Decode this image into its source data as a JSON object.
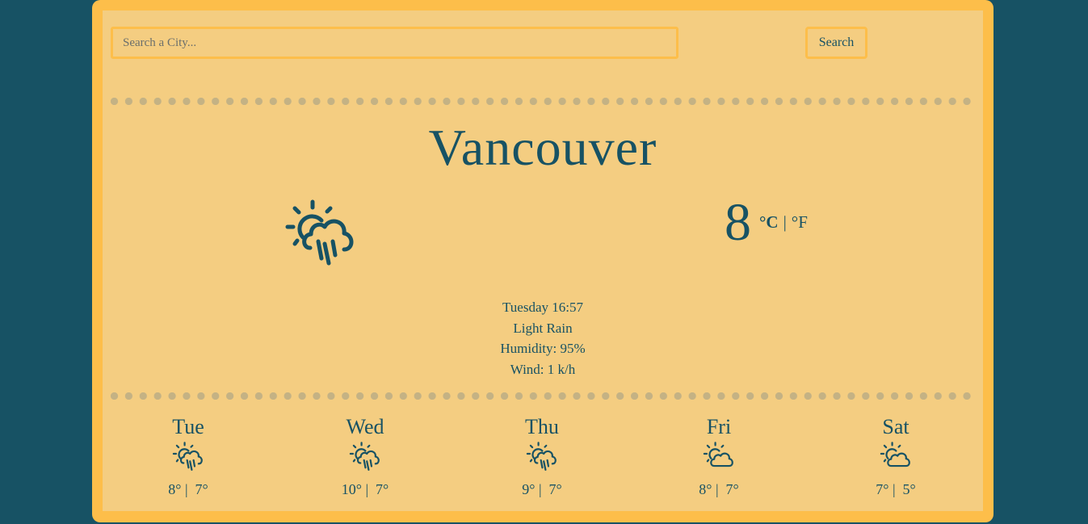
{
  "search": {
    "placeholder": "Search a City...",
    "value": "",
    "button_label": "Search"
  },
  "current": {
    "city": "Vancouver",
    "icon": "sun-cloud-rain-icon",
    "temperature": "8",
    "unit_celsius": "°C",
    "unit_separator": "|",
    "unit_fahrenheit": "°F",
    "datetime": "Tuesday 16:57",
    "description": "Light Rain",
    "humidity": "Humidity: 95%",
    "wind": "Wind: 1 k/h"
  },
  "forecast": [
    {
      "day": "Tue",
      "icon": "sun-cloud-rain-icon",
      "temps": "8° |  7°"
    },
    {
      "day": "Wed",
      "icon": "sun-cloud-rain-icon",
      "temps": "10° |  7°"
    },
    {
      "day": "Thu",
      "icon": "sun-cloud-rain-icon",
      "temps": "9° |  7°"
    },
    {
      "day": "Fri",
      "icon": "sun-cloud-icon",
      "temps": "8° |  7°"
    },
    {
      "day": "Sat",
      "icon": "sun-cloud-icon",
      "temps": "7° |  5°"
    }
  ],
  "colors": {
    "background": "#175264",
    "card_border": "#fdbe4a",
    "card_fill": "#f4cd81",
    "text": "#175264",
    "dots": "#c4b284"
  }
}
